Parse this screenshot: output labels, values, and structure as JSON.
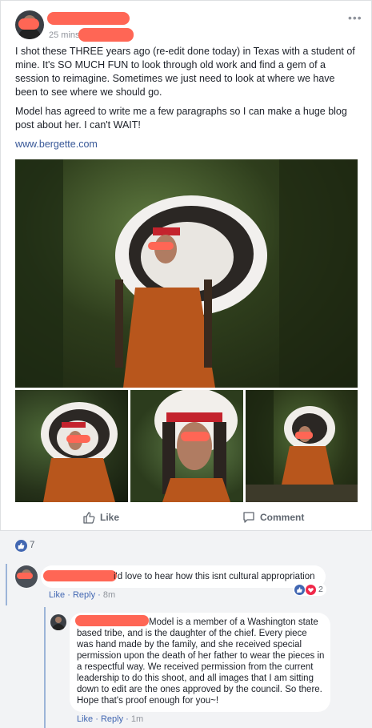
{
  "post": {
    "time": "25 mins",
    "paragraphs": [
      "I shot these THREE years ago (re-edit done today) in Texas with a student of mine. It's SO MUCH FUN to look through old work and find a gem of a session to reimagine. Sometimes we just need to look at where we have been to see where we should go.",
      "Model has agreed to write me a few paragraphs so I can make a huge blog post about her. I can't WAIT!"
    ],
    "link": "www.bergette.com",
    "more_icon": "•••"
  },
  "actions": {
    "like": "Like",
    "comment": "Comment"
  },
  "reactions": {
    "count": "7"
  },
  "comments": [
    {
      "text": "i'd love to hear how this isnt cultural appropriation",
      "like": "Like",
      "reply": "Reply",
      "time": "8m",
      "reaction_count": "2"
    }
  ],
  "reply": {
    "text": "Model is a member of a Washington state based tribe, and is the daughter of the chief. Every piece was hand made by the family, and she received special permission upon the death of her father to wear the pieces in a respectful way. We received permission from the current leadership to do this shoot, and all images that I am sitting down to edit are the ones approved by the council. So there. Hope that's proof enough for you~!",
    "like": "Like",
    "reply": "Reply",
    "time": "1m"
  },
  "colors": {
    "link": "#385898",
    "accent": "#4267b2",
    "redaction": "#ff6655"
  }
}
